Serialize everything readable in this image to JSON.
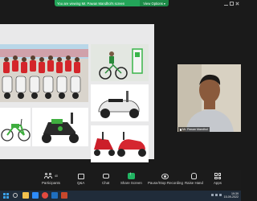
{
  "share_banner": {
    "message": "You are viewing Mr. Pawan Mandhol's screen",
    "view_options_label": "View Options",
    "accent": "#23a559"
  },
  "video": {
    "participant_name": "Mr. Pawan Mandhol"
  },
  "toolbar": {
    "participants_label": "Participants",
    "participants_count": "40",
    "qa_label": "Q&A",
    "chat_label": "Chat",
    "share_label": "Share Screen",
    "record_label": "Pause/Stop Recording",
    "raise_hand_label": "Raise Hand",
    "apps_label": "Apps"
  },
  "taskbar": {
    "time": "19:39",
    "date": "15-09-2022"
  },
  "colors": {
    "toolbar_bg": "#1b1b1b",
    "taskbar_bg": "#202c3a",
    "share_green": "#21b462"
  }
}
